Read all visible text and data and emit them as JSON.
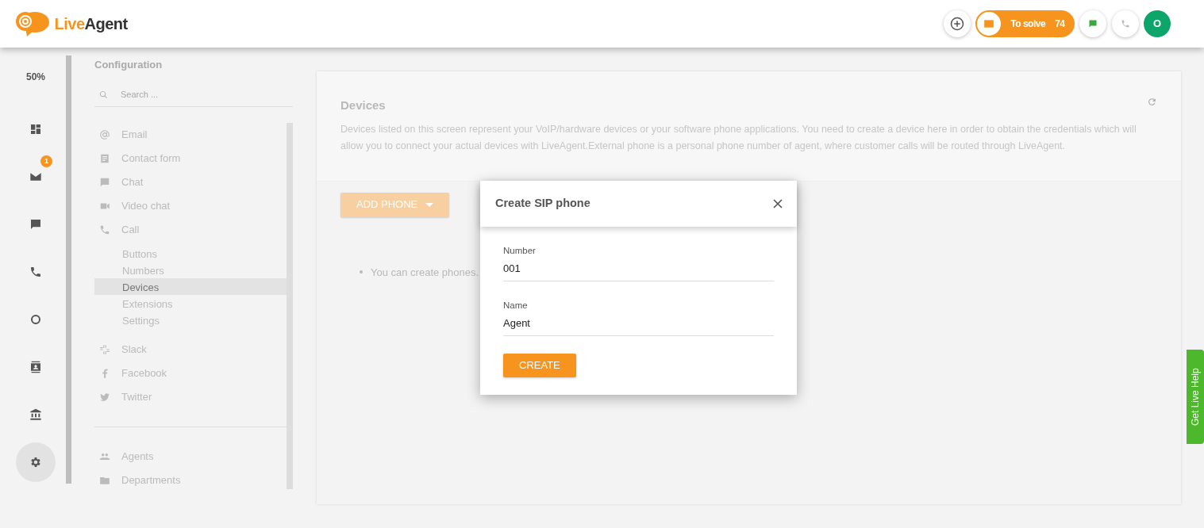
{
  "header": {
    "logo": {
      "primary": "Live",
      "secondary": "Agent"
    },
    "to_solve": {
      "label": "To solve",
      "count": "74"
    },
    "avatar": {
      "initial": "O"
    }
  },
  "rail": {
    "zoom": "50%",
    "items": [
      {
        "kind": "dashboard",
        "selected": false
      },
      {
        "kind": "email",
        "badge": "1",
        "selected": false
      },
      {
        "kind": "chat",
        "selected": false
      },
      {
        "kind": "call",
        "selected": false
      },
      {
        "kind": "reports",
        "selected": false
      },
      {
        "kind": "contacts",
        "selected": false
      },
      {
        "kind": "knowledgebase",
        "selected": false
      },
      {
        "kind": "settings",
        "selected": true
      }
    ]
  },
  "config": {
    "title": "Configuration",
    "search": {
      "placeholder": "Search ..."
    },
    "groups": [
      {
        "items": [
          {
            "label": "Email",
            "selected": false
          },
          {
            "label": "Contact form",
            "selected": false
          },
          {
            "label": "Chat",
            "selected": false
          },
          {
            "label": "Video chat",
            "selected": false
          },
          {
            "label": "Call",
            "selected": false,
            "children": [
              {
                "label": "Buttons",
                "selected": false
              },
              {
                "label": "Numbers",
                "selected": false
              },
              {
                "label": "Devices",
                "selected": true
              },
              {
                "label": "Extensions",
                "selected": false
              },
              {
                "label": "Settings",
                "selected": false
              }
            ]
          }
        ]
      },
      {
        "items": [
          {
            "label": "Slack",
            "selected": false
          },
          {
            "label": "Facebook",
            "selected": false
          },
          {
            "label": "Twitter",
            "selected": false
          }
        ]
      },
      {
        "items": [
          {
            "label": "Agents",
            "selected": false
          },
          {
            "label": "Departments",
            "selected": false
          }
        ]
      }
    ]
  },
  "main": {
    "title": "Devices",
    "description": "Devices listed on this screen represent your VoIP/hardware devices or your software phone applications. You need to create a device here in order to obtain the credentials which will allow you to connect your actual devices with LiveAgent.External phone is a personal phone number of agent, where customer calls will be routed through LiveAgent.",
    "add_button": "ADD PHONE",
    "notes": [
      "You can create phones."
    ]
  },
  "modal": {
    "title": "Create SIP phone",
    "fields": [
      {
        "label": "Number",
        "value": "001"
      },
      {
        "label": "Name",
        "value": "Agent"
      }
    ],
    "submit": "CREATE"
  },
  "live_help": "Get Live Help"
}
